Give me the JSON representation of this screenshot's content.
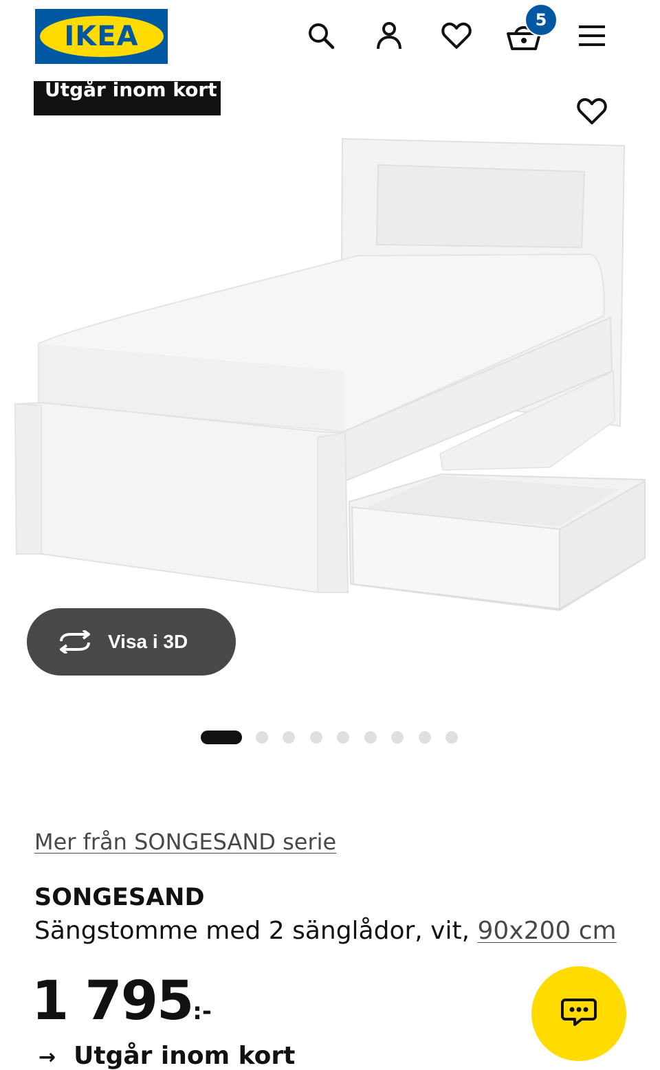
{
  "header": {
    "logo_text": "IKEA",
    "logo_colors": {
      "background": "#0058a3",
      "oval": "#ffdb00",
      "text": "#0058a3"
    },
    "icons": [
      "search-icon",
      "account-icon",
      "heart-icon",
      "cart-icon",
      "menu-icon"
    ],
    "cart_count": "5"
  },
  "gallery": {
    "tag_label": "Utgår inom kort",
    "view_3d_label": "Visa i 3D",
    "slide_count": 9,
    "active_slide": 1
  },
  "product": {
    "series_link": "Mer från SONGESAND serie",
    "name": "SONGESAND",
    "description": "Sängstomme med 2 sänglådor, vit, ",
    "size_link": "90x200 cm",
    "price": "1 795",
    "price_suffix": ":-",
    "stock_text": "Utgår inom kort"
  },
  "colors": {
    "accent_blue": "#0058a3",
    "accent_yellow": "#ffdb00",
    "dark_button": "#484848"
  }
}
